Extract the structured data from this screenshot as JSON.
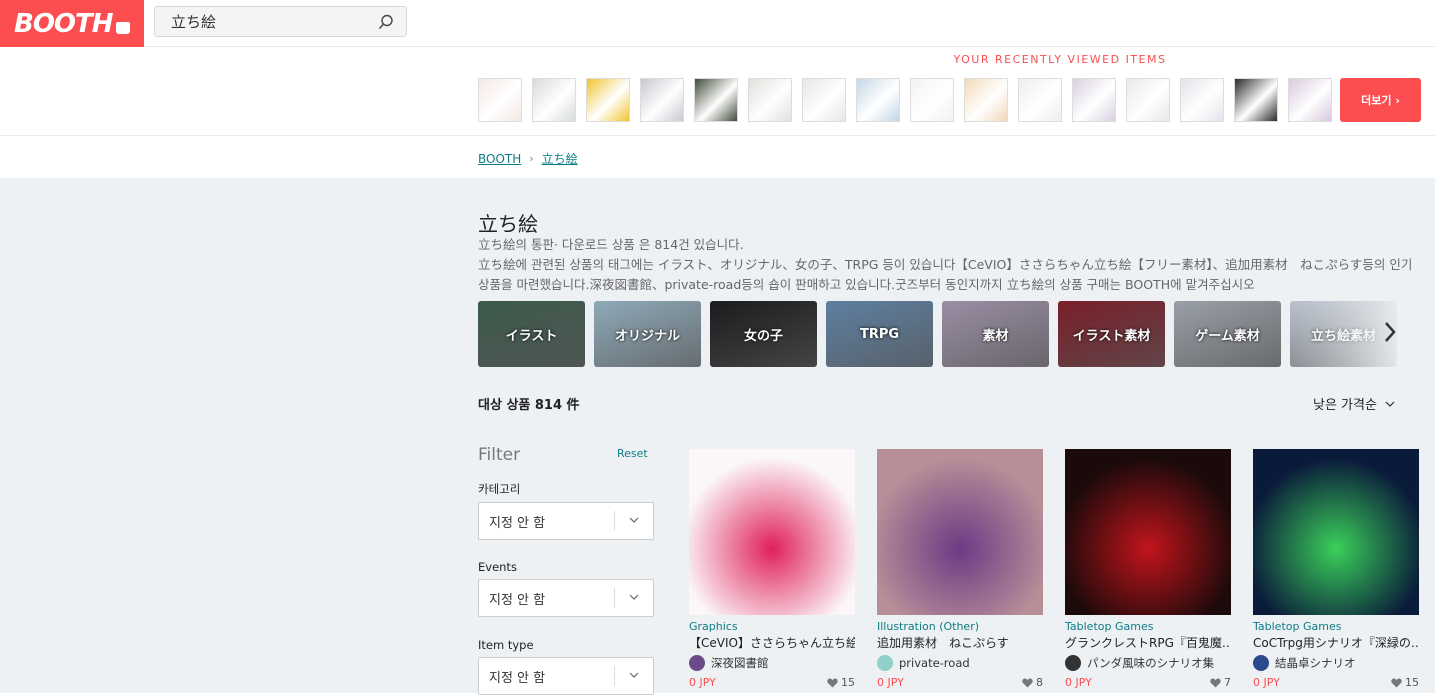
{
  "header": {
    "logo": "BOOTH",
    "search_value": "立ち絵"
  },
  "recent": {
    "title": "YOUR RECENTLY VIEWED ITEMS",
    "more_label": "더보기 ›",
    "thumb_colors": [
      "#f4e8e4",
      "#d7dbd6",
      "#f1c431",
      "#c9c8d0",
      "#3f4a3a",
      "#dfe0dc",
      "#e8e6e6",
      "#c4d6e6",
      "#f2f2f2",
      "#f1d8b8",
      "#eeeeee",
      "#d8d0e0",
      "#e8e8ec",
      "#e4e2ea",
      "#2a2a2a",
      "#d8c8e0"
    ]
  },
  "breadcrumb": {
    "root": "BOOTH",
    "current": "立ち絵"
  },
  "tag": {
    "title": "立ち絵",
    "desc1": "立ち絵의 통판· 다운로드 상품 은 814건 있습니다.",
    "desc2": "立ち絵에 관련된 상품의 태그에는 イラスト、オリジナル、女の子、TRPG 등이 있습니다【CeVIO】ささらちゃん立ち絵【フリー素材】、追加用素材　ねこぷらす등의 인기상품을 마련했습니다.深夜図書館、private-road등의 숍이 판매하고 있습니다.굿즈부터 동인지까지 立ち絵의 상품 구매는 BOOTH에 맡겨주십시오"
  },
  "categories": [
    {
      "label": "イラスト",
      "color": "#3d5a4c"
    },
    {
      "label": "オリジナル",
      "color": "#8fa9b8"
    },
    {
      "label": "女の子",
      "color": "#1c1c1e"
    },
    {
      "label": "TRPG",
      "color": "#5e7fa0"
    },
    {
      "label": "素材",
      "color": "#9a8ea4"
    },
    {
      "label": "イラスト素材",
      "color": "#7a1f2a"
    },
    {
      "label": "ゲーム素材",
      "color": "#9aa0a8"
    },
    {
      "label": "立ち絵素材",
      "color": "#b8c0cc"
    }
  ],
  "results": {
    "count": "대상 상품 814 件",
    "sort": "낮은 가격순"
  },
  "filter": {
    "title": "Filter",
    "reset": "Reset",
    "category_label": "카테고리",
    "category_value": "지정 안 함",
    "events_label": "Events",
    "events_value": "지정 안 함",
    "itemtype_label": "Item type",
    "itemtype_value": "지정 안 함"
  },
  "products": [
    {
      "category": "Graphics",
      "title": "【CeVIO】ささらちゃん立ち絵…",
      "shop": "深夜図書館",
      "price": "0 JPY",
      "likes": "15",
      "bg": "#fbf6f8",
      "accent": "#e0205a",
      "avatar": "#6a4a8a"
    },
    {
      "category": "Illustration (Other)",
      "title": "追加用素材　ねこぷらす",
      "shop": "private-road",
      "price": "0 JPY",
      "likes": "8",
      "bg": "#b88e98",
      "accent": "#6b3a84",
      "avatar": "#8fd0c8"
    },
    {
      "category": "Tabletop Games",
      "title": "グランクレストRPG『百鬼魔…",
      "shop": "パンダ風味のシナリオ集",
      "price": "0 JPY",
      "likes": "7",
      "bg": "#1a0a0a",
      "accent": "#c2141c",
      "avatar": "#333333"
    },
    {
      "category": "Tabletop Games",
      "title": "CoCTrpg用シナリオ『深緑の…",
      "shop": "結晶卓シナリオ",
      "price": "0 JPY",
      "likes": "15",
      "bg": "#0a1a3a",
      "accent": "#3ad05a",
      "avatar": "#2a4a8a"
    }
  ]
}
